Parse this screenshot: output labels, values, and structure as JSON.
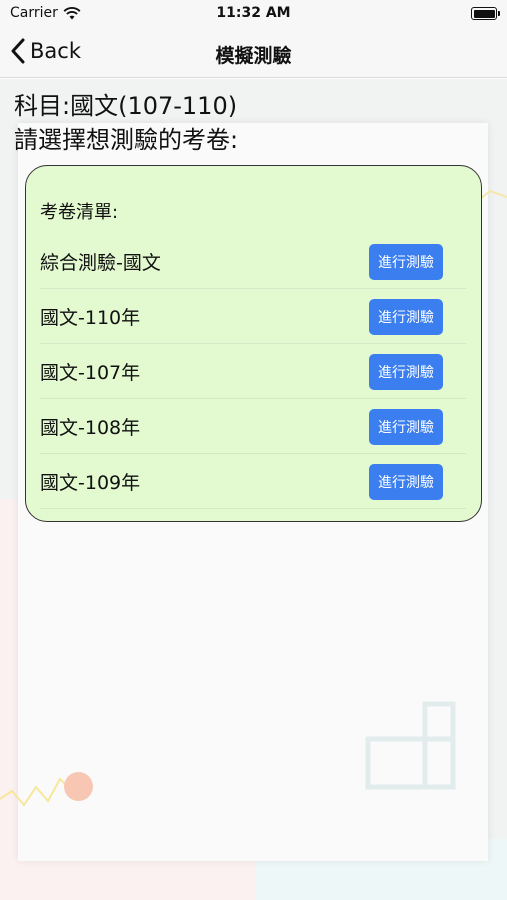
{
  "status_bar": {
    "carrier": "Carrier",
    "time": "11:32 AM"
  },
  "nav": {
    "back_label": "Back",
    "title": "模擬測驗"
  },
  "subject_line": "科目:國文(107-110)",
  "prompt_line": "請選擇想測驗的考卷:",
  "exam_list": {
    "title": "考卷清單:",
    "items": [
      {
        "label": "綜合測驗-國文",
        "button": "進行測驗"
      },
      {
        "label": "國文-110年",
        "button": "進行測驗"
      },
      {
        "label": "國文-107年",
        "button": "進行測驗"
      },
      {
        "label": "國文-108年",
        "button": "進行測驗"
      },
      {
        "label": "國文-109年",
        "button": "進行測驗"
      }
    ]
  },
  "colors": {
    "card_bg": "#e3f9d0",
    "button_bg": "#3a7ef0",
    "button_text": "#ffffff"
  }
}
